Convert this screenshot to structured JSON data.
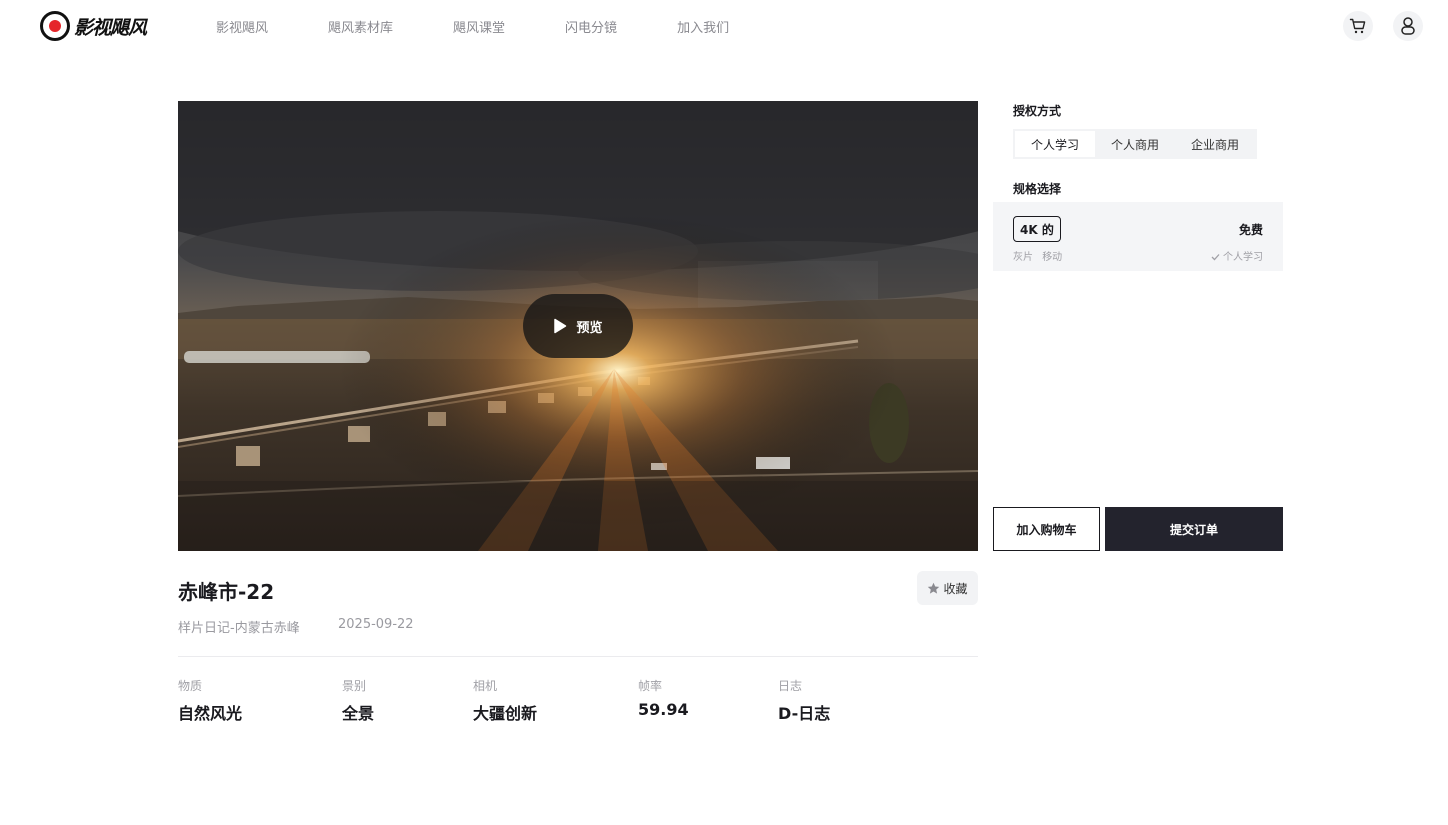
{
  "header": {
    "logo_text": "影视飓风",
    "nav": [
      {
        "label": "影视飓风"
      },
      {
        "label": "飓风素材库"
      },
      {
        "label": "飓风课堂"
      },
      {
        "label": "闪电分镜"
      },
      {
        "label": "加入我们"
      }
    ],
    "icons": {
      "cart": "cart-icon",
      "user": "user-icon"
    }
  },
  "video": {
    "preview_label": "预览"
  },
  "clip": {
    "title": "赤峰市-22",
    "favorite_label": "收藏",
    "series": "样片日记-内蒙古赤峰",
    "date": "2025-09-22",
    "attributes": [
      {
        "label": "物质",
        "value": "自然风光"
      },
      {
        "label": "景别",
        "value": "全景"
      },
      {
        "label": "相机",
        "value": "大疆创新"
      },
      {
        "label": "帧率",
        "value": "59.94"
      },
      {
        "label": "日志",
        "value": "D-日志"
      }
    ]
  },
  "panel": {
    "license_title": "授权方式",
    "license_options": [
      "个人学习",
      "个人商用",
      "企业商用"
    ],
    "license_selected": "个人学习",
    "spec_title": "规格选择",
    "spec": {
      "badge": "4K 的",
      "tags": [
        "灰片",
        "移动"
      ],
      "price": "免费",
      "check_label": "个人学习"
    },
    "add_to_cart": "加入购物车",
    "submit_order": "提交订单"
  },
  "colors": {
    "accent_dark": "#23232d",
    "brand_red": "#e5262b",
    "panel_bg": "#f4f5f7"
  }
}
